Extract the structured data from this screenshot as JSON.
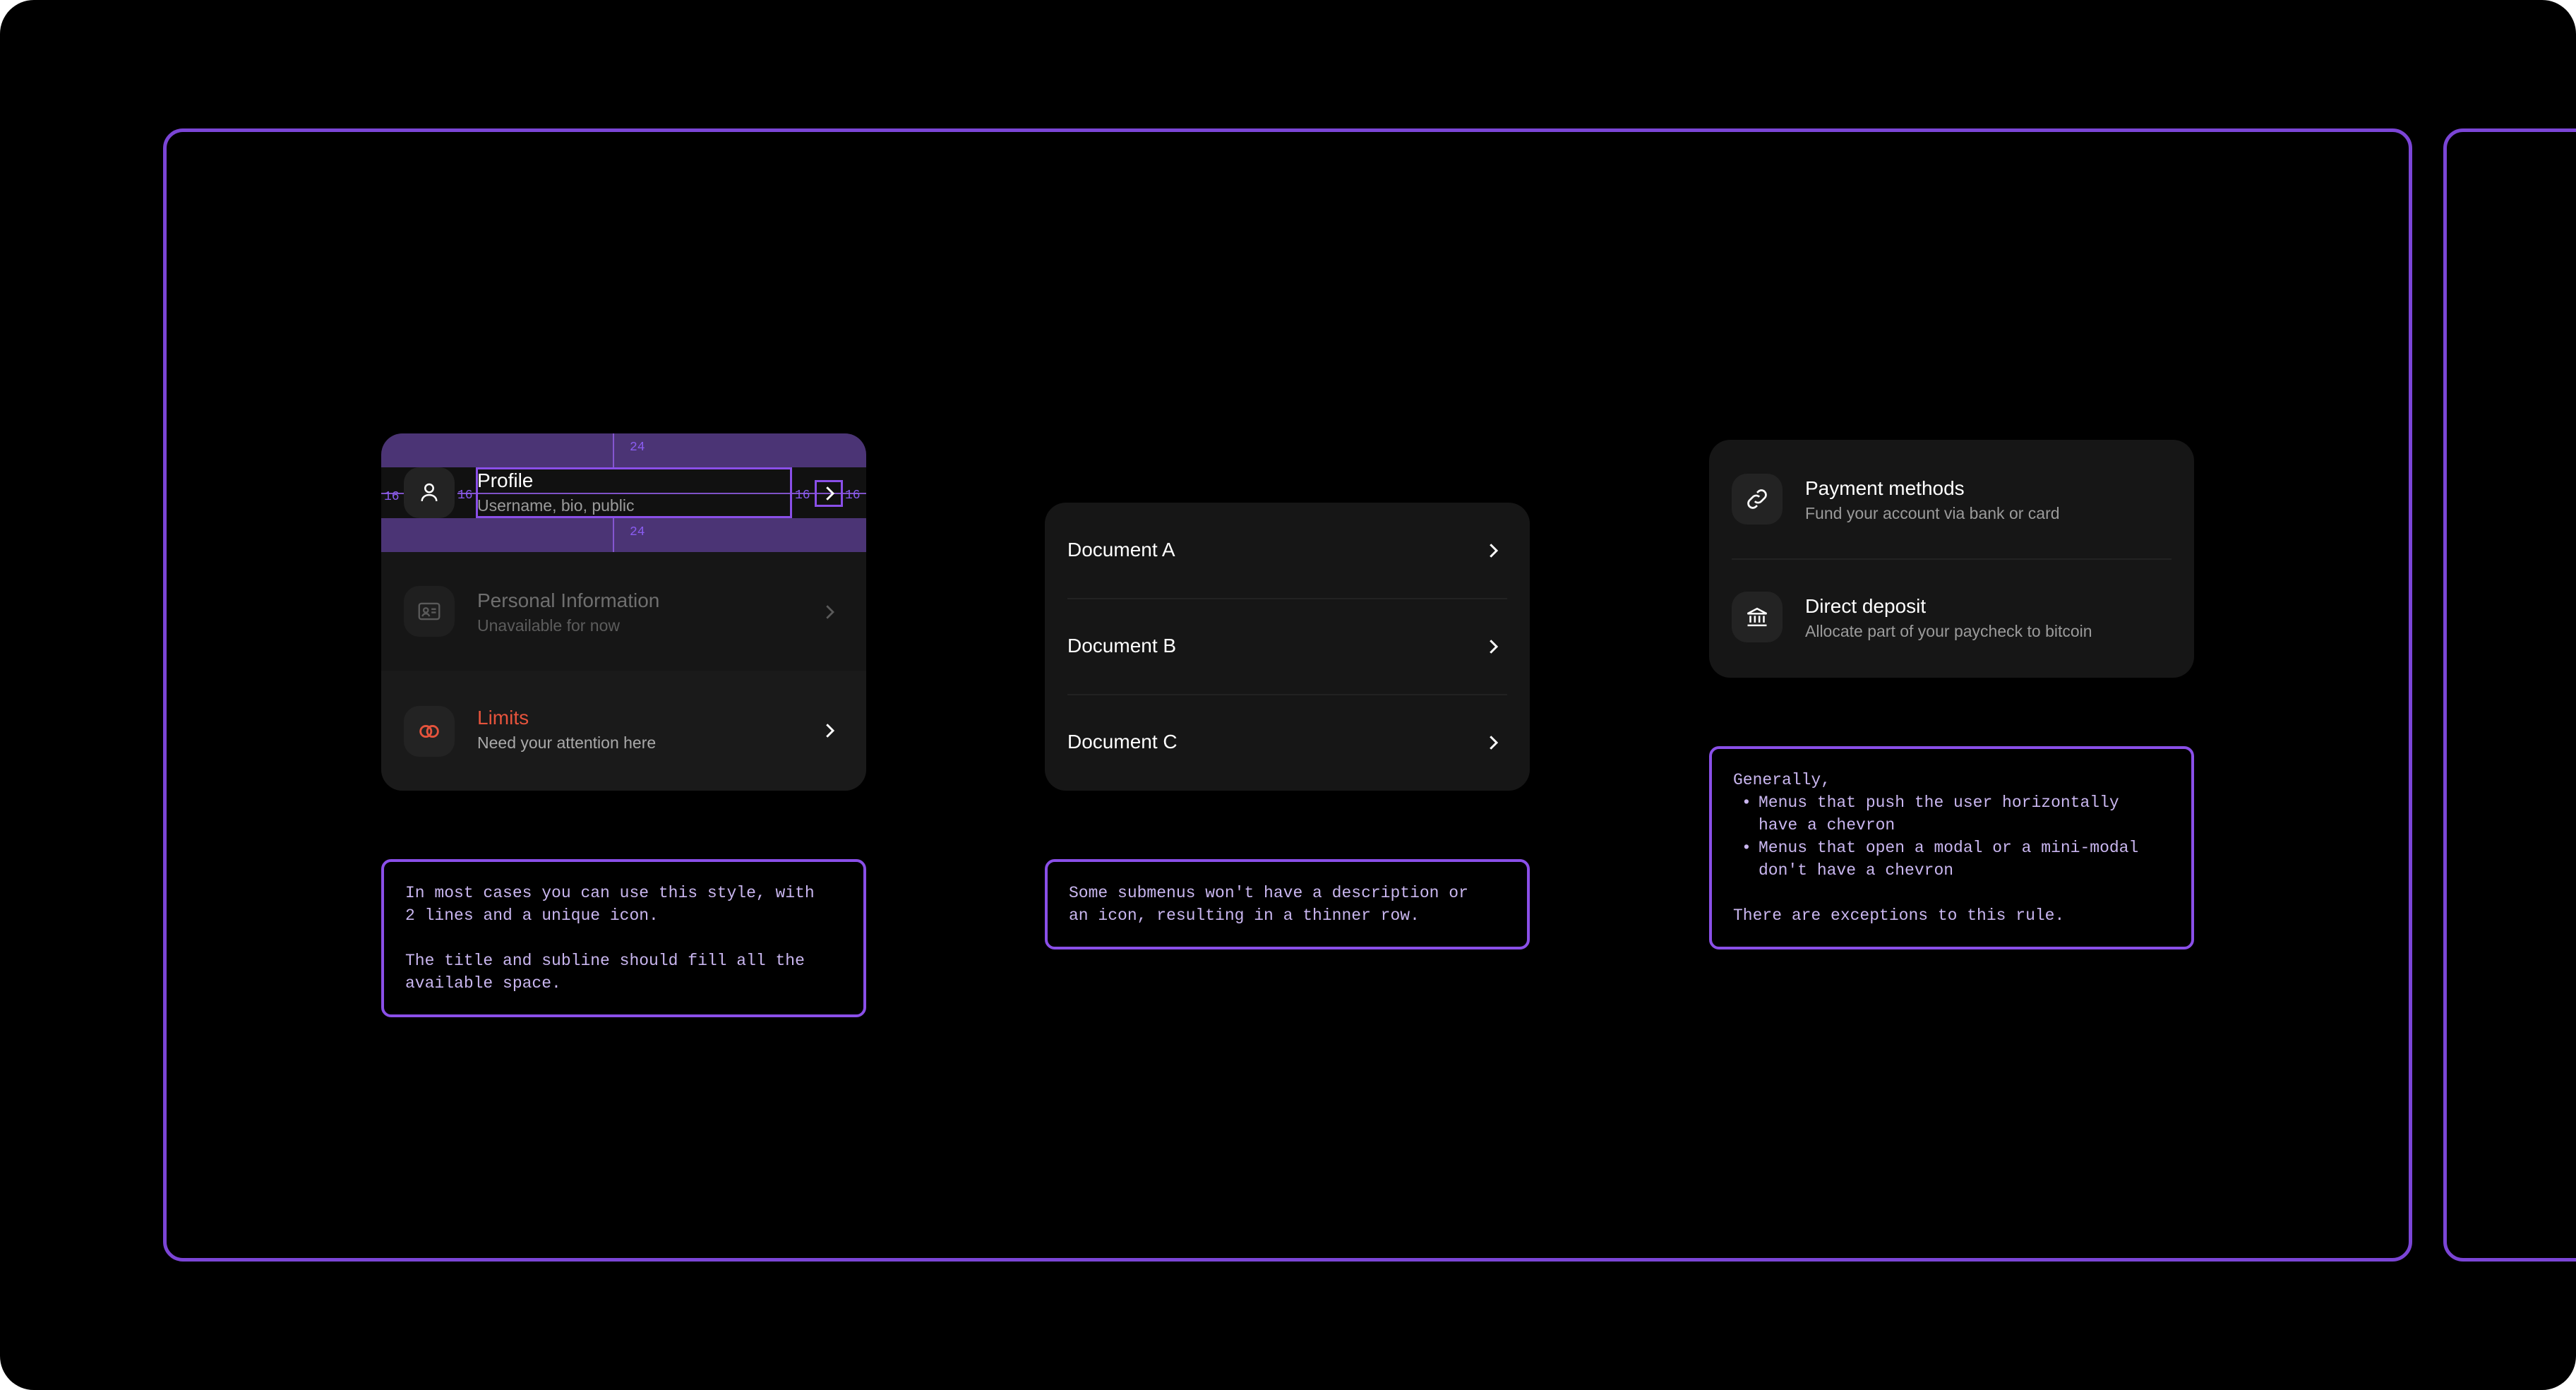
{
  "column1": {
    "rows": [
      {
        "title": "Profile",
        "subtitle": "Username, bio, public",
        "icon": "person-icon"
      },
      {
        "title": "Personal Information",
        "subtitle": "Unavailable for now",
        "icon": "id-card-icon"
      },
      {
        "title": "Limits",
        "subtitle": "Need your attention here",
        "icon": "limits-rings-icon"
      }
    ],
    "measurements": {
      "top": "24",
      "bottom": "24",
      "left": "16",
      "gap": "16",
      "right_gap": "16",
      "right": "16"
    },
    "note_lines": [
      "In most cases you can use this style, with",
      "2 lines and a unique icon.",
      "",
      "The title and subline should fill all the",
      "available space."
    ]
  },
  "column2": {
    "rows": [
      {
        "title": "Document A"
      },
      {
        "title": "Document B"
      },
      {
        "title": "Document C"
      }
    ],
    "note_lines": [
      "Some submenus won't have a description or",
      "an icon, resulting in a thinner row."
    ]
  },
  "column3": {
    "rows": [
      {
        "title": "Payment methods",
        "subtitle": "Fund your account via bank or card",
        "icon": "link-icon"
      },
      {
        "title": "Direct deposit",
        "subtitle": "Allocate part of your paycheck to bitcoin",
        "icon": "bank-icon"
      }
    ],
    "note": {
      "intro": "Generally,",
      "bullet1_line1": "Menus that push the user horizontally",
      "bullet1_line2": "have a chevron",
      "bullet2_line1": "Menus that open a modal or a mini-modal",
      "bullet2_line2": "don't have a chevron",
      "outro": "There are exceptions to this rule."
    }
  },
  "colors": {
    "background": "#000000",
    "card": "#161616",
    "accent": "#8a4fe8",
    "danger": "#e5533c",
    "text": "#ffffff",
    "muted": "#9b9b9b"
  }
}
